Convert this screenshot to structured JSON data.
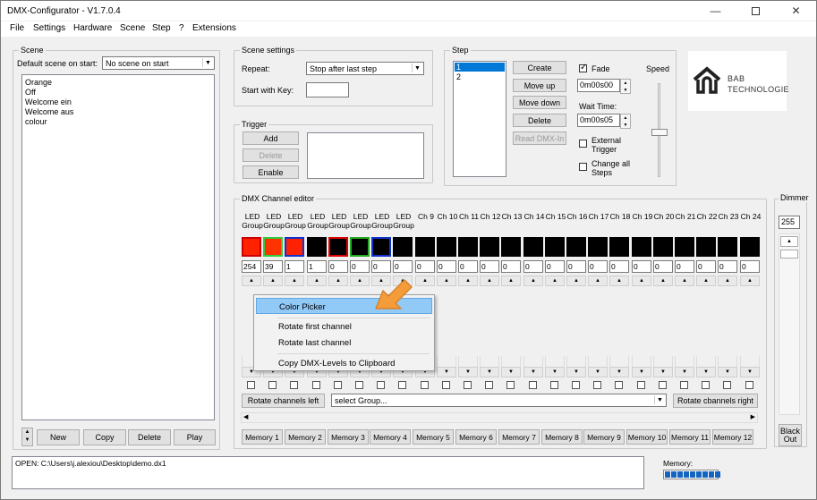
{
  "window": {
    "title": "DMX-Configurator - V1.7.0.4"
  },
  "menu": [
    "File",
    "Settings",
    "Hardware",
    "Scene",
    "Step",
    "?",
    "Extensions"
  ],
  "scene": {
    "group_label": "Scene",
    "default_label": "Default scene on start:",
    "default_value": "No scene on start",
    "items": [
      "Orange",
      "Off",
      "Welcome ein",
      "Welcome aus",
      "colour"
    ],
    "buttons": {
      "new": "New",
      "copy": "Copy",
      "delete": "Delete",
      "play": "Play"
    }
  },
  "scene_settings": {
    "group_label": "Scene settings",
    "repeat_label": "Repeat:",
    "repeat_value": "Stop after last step",
    "start_key_label": "Start with Key:",
    "start_key_value": ""
  },
  "trigger": {
    "group_label": "Trigger",
    "add": "Add",
    "delete": "Delete",
    "enable": "Enable"
  },
  "step": {
    "group_label": "Step",
    "items": [
      "1",
      "2"
    ],
    "buttons": {
      "create": "Create",
      "move_up": "Move up",
      "move_down": "Move down",
      "delete": "Delete",
      "read": "Read DMX-In"
    },
    "fade_label": "Fade",
    "fade_value": "0m00s00",
    "wait_label": "Wait Time:",
    "wait_value": "0m00s05",
    "external_trigger": "External Trigger",
    "change_all": "Change all Steps",
    "speed_label": "Speed"
  },
  "logo": {
    "line1": "BAB",
    "line2": "TECHNOLOGIE"
  },
  "dimmer": {
    "label": "Dimmer",
    "value": "255",
    "blackout": "Black Out"
  },
  "editor": {
    "group_label": "DMX Channel editor",
    "channels": [
      {
        "label": "LED Group",
        "value": "254",
        "color": "#ff2200",
        "border": "#cc0000"
      },
      {
        "label": "LED Group",
        "value": "39",
        "color": "#ff3300",
        "border": "#2ecc40"
      },
      {
        "label": "LED Group",
        "value": "1",
        "color": "#ff2200",
        "border": "#1133cc"
      },
      {
        "label": "LED Group",
        "value": "1",
        "color": "#000000",
        "border": "#000000"
      },
      {
        "label": "LED Group",
        "value": "0",
        "color": "#000000",
        "border": "#dd0000"
      },
      {
        "label": "LED Group",
        "value": "0",
        "color": "#000000",
        "border": "#22aa22"
      },
      {
        "label": "LED Group",
        "value": "0",
        "color": "#000000",
        "border": "#1133cc"
      },
      {
        "label": "LED Group",
        "value": "0",
        "color": "#000000",
        "border": "#000000"
      },
      {
        "label": "Ch 9",
        "value": "0",
        "color": "#000000",
        "border": "#000000"
      },
      {
        "label": "Ch 10",
        "value": "0",
        "color": "#000000",
        "border": "#000000"
      },
      {
        "label": "Ch 11",
        "value": "0",
        "color": "#000000",
        "border": "#000000"
      },
      {
        "label": "Ch 12",
        "value": "0",
        "color": "#000000",
        "border": "#000000"
      },
      {
        "label": "Ch 13",
        "value": "0",
        "color": "#000000",
        "border": "#000000"
      },
      {
        "label": "Ch 14",
        "value": "0",
        "color": "#000000",
        "border": "#000000"
      },
      {
        "label": "Ch 15",
        "value": "0",
        "color": "#000000",
        "border": "#000000"
      },
      {
        "label": "Ch 16",
        "value": "0",
        "color": "#000000",
        "border": "#000000"
      },
      {
        "label": "Ch 17",
        "value": "0",
        "color": "#000000",
        "border": "#000000"
      },
      {
        "label": "Ch 18",
        "value": "0",
        "color": "#000000",
        "border": "#000000"
      },
      {
        "label": "Ch 19",
        "value": "0",
        "color": "#000000",
        "border": "#000000"
      },
      {
        "label": "Ch 20",
        "value": "0",
        "color": "#000000",
        "border": "#000000"
      },
      {
        "label": "Ch 21",
        "value": "0",
        "color": "#000000",
        "border": "#000000"
      },
      {
        "label": "Ch 22",
        "value": "0",
        "color": "#000000",
        "border": "#000000"
      },
      {
        "label": "Ch 23",
        "value": "0",
        "color": "#000000",
        "border": "#000000"
      },
      {
        "label": "Ch 24",
        "value": "0",
        "color": "#000000",
        "border": "#000000"
      }
    ],
    "rotate_left": "Rotate channels left",
    "select_group": "select Group...",
    "rotate_right": "Rotate cbannels right",
    "memories": [
      "Memory 1",
      "Memory 2",
      "Memory 3",
      "Memory 4",
      "Memory 5",
      "Memory 6",
      "Memory 7",
      "Memory 8",
      "Memory 9",
      "Memory 10",
      "Memory 11",
      "Memory 12"
    ]
  },
  "context_menu": {
    "items": [
      "Color Picker",
      "Rotate first channel",
      "Rotate last channel",
      "Copy DMX-Levels to Clipboard"
    ]
  },
  "status": {
    "text": "OPEN: C:\\Users\\j.alexiou\\Desktop\\demo.dx1",
    "memory_label": "Memory:",
    "memory_fraction": 0.95
  }
}
